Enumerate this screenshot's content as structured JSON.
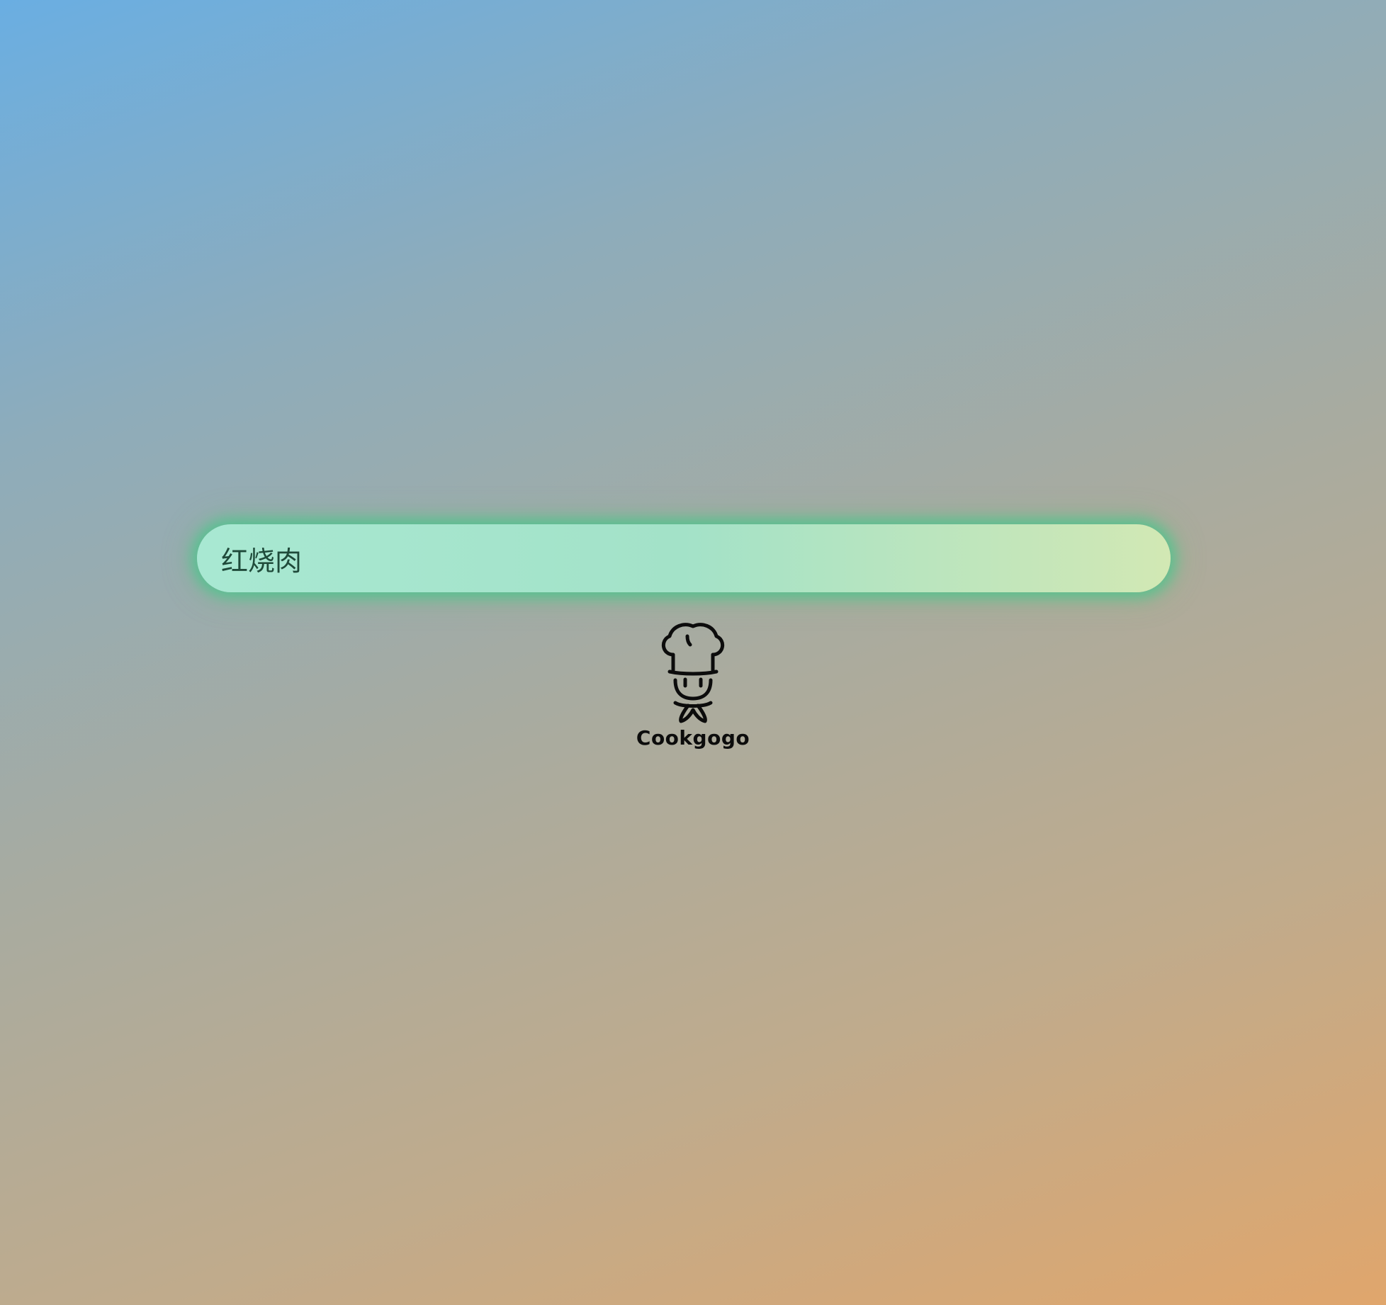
{
  "search": {
    "value": "红烧肉",
    "placeholder": ""
  },
  "logo": {
    "icon": "chef-icon",
    "brand_name": "Cookgogo"
  },
  "colors": {
    "glow": "#48c48e",
    "input_start": "#a8e8d2",
    "input_end": "#d2e8b4",
    "text": "#1f4a3a"
  }
}
